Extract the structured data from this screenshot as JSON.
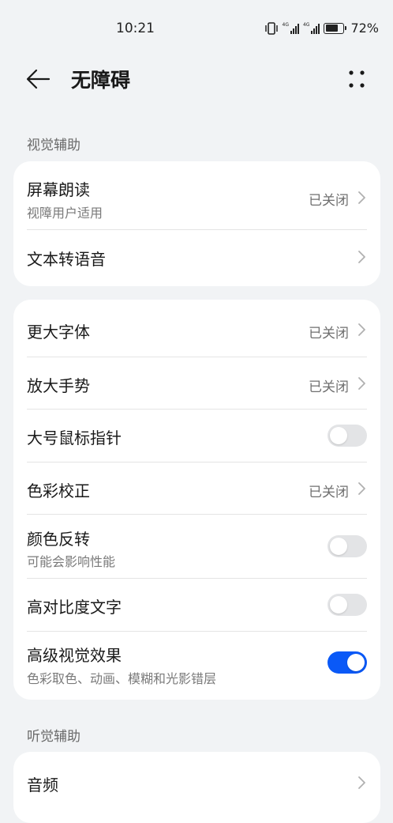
{
  "status": {
    "time": "10:21",
    "signal1_label": "4G",
    "signal2_label": "4G",
    "battery_percent": "72%",
    "battery_level": 0.72
  },
  "app_bar": {
    "title": "无障碍",
    "back_icon": "arrow-left-icon",
    "more_icon": "more-dots-icon"
  },
  "sections": {
    "visual": {
      "header": "视觉辅助"
    },
    "hearing": {
      "header": "听觉辅助"
    }
  },
  "visual_card1": {
    "screen_reader": {
      "title": "屏幕朗读",
      "subtitle": "视障用户适用",
      "value": "已关闭"
    },
    "tts": {
      "title": "文本转语音"
    }
  },
  "visual_card2": {
    "larger_font": {
      "title": "更大字体",
      "value": "已关闭"
    },
    "magnify": {
      "title": "放大手势",
      "value": "已关闭"
    },
    "large_pointer": {
      "title": "大号鼠标指针",
      "toggle_on": false
    },
    "color_correction": {
      "title": "色彩校正",
      "value": "已关闭"
    },
    "color_inversion": {
      "title": "颜色反转",
      "subtitle": "可能会影响性能",
      "toggle_on": false
    },
    "high_contrast": {
      "title": "高对比度文字",
      "toggle_on": false
    },
    "advanced_visual": {
      "title": "高级视觉效果",
      "subtitle": "色彩取色、动画、模糊和光影错层",
      "toggle_on": true
    }
  },
  "hearing_card": {
    "audio": {
      "title": "音频"
    }
  },
  "colors": {
    "accent": "#0a59f7",
    "background": "#f1f3f5"
  }
}
